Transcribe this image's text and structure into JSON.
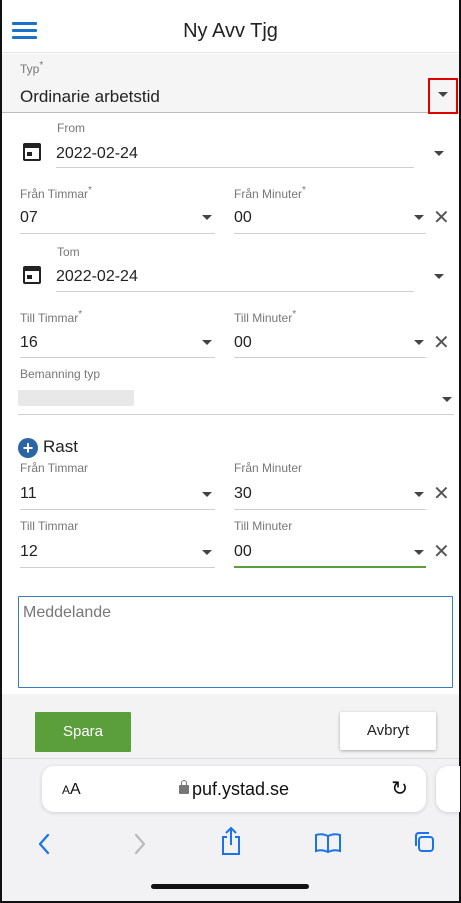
{
  "header": {
    "title": "Ny Avv Tjg"
  },
  "typ": {
    "label": "Typ",
    "required": "*",
    "value": "Ordinarie arbetstid"
  },
  "from": {
    "label": "From",
    "date": "2022-02-24"
  },
  "fran_timmar": {
    "label": "Från Timmar",
    "required": "*",
    "value": "07"
  },
  "fran_minuter": {
    "label": "Från Minuter",
    "required": "*",
    "value": "00"
  },
  "tom": {
    "label": "Tom",
    "date": "2022-02-24"
  },
  "till_timmar": {
    "label": "Till Timmar",
    "required": "*",
    "value": "16"
  },
  "till_minuter": {
    "label": "Till Minuter",
    "required": "*",
    "value": "00"
  },
  "bemanning": {
    "label": "Bemanning typ",
    "value": ""
  },
  "rast": {
    "title": "Rast",
    "fran_timmar": {
      "label": "Från Timmar",
      "value": "11"
    },
    "fran_minuter": {
      "label": "Från Minuter",
      "value": "30"
    },
    "till_timmar": {
      "label": "Till Timmar",
      "value": "12"
    },
    "till_minuter": {
      "label": "Till Minuter",
      "value": "00"
    }
  },
  "message": {
    "placeholder": "Meddelande"
  },
  "buttons": {
    "save": "Spara",
    "cancel": "Avbryt"
  },
  "browser": {
    "aa_small": "A",
    "aa_big": "A",
    "url": "puf.ystad.se"
  },
  "colors": {
    "accent": "#1a73c8",
    "save": "#5b9e3c",
    "highlight": "#e00000"
  },
  "icons": {
    "menu": "hamburger-icon",
    "calendar": "calendar-icon",
    "dropdown": "chevron-down-icon",
    "clear": "close-icon",
    "add": "plus-circle-icon",
    "reload": "reload-icon",
    "back": "back-icon",
    "forward": "forward-icon",
    "share": "share-icon",
    "bookmarks": "book-icon",
    "tabs": "tabs-icon"
  }
}
